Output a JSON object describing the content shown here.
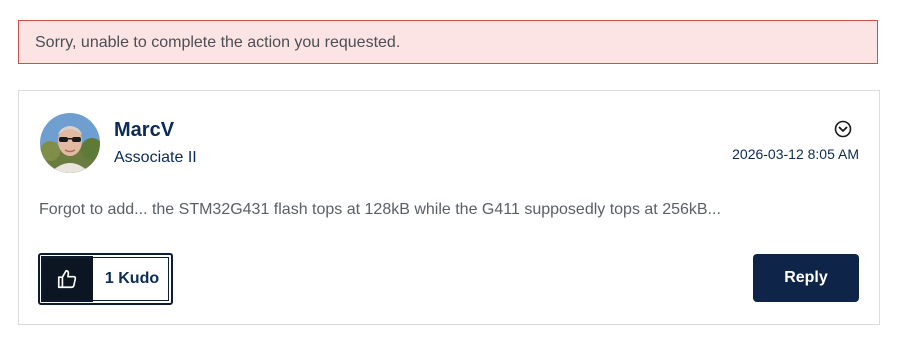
{
  "error_banner": {
    "message": "Sorry, unable to complete the action you requested."
  },
  "post": {
    "author": {
      "name": "MarcV",
      "rank": "Associate II",
      "avatar": "user-photo"
    },
    "options_icon": "chevron-circle-down-icon",
    "timestamp": "2026-03-12 8:05 AM",
    "body": "Forgot to add... the STM32G431 flash tops at 128kB while the G411 supposedly tops at 256kB...",
    "kudo": {
      "icon": "thumbs-up-icon",
      "label": "1 Kudo"
    },
    "reply_label": "Reply"
  },
  "colors": {
    "error_bg": "#fce4e4",
    "error_border": "#c9504d",
    "brand_navy": "#0f2449",
    "text_navy": "#0b2a55"
  }
}
